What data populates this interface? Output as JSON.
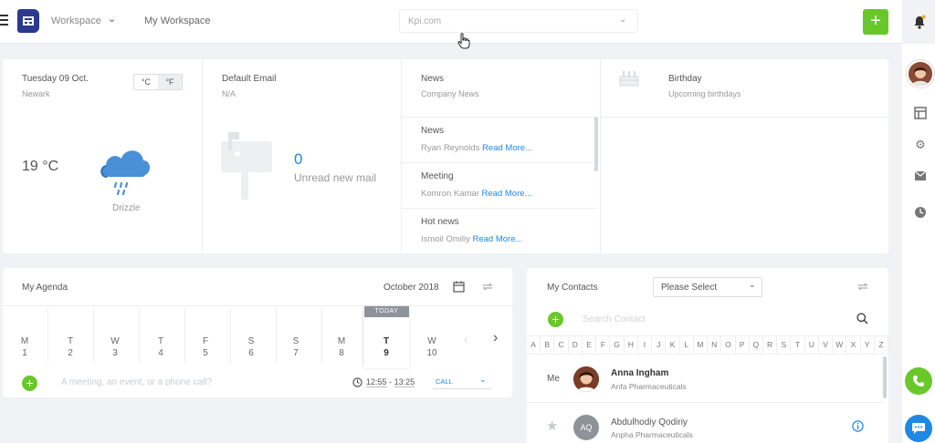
{
  "header": {
    "workspace_label": "Workspace",
    "workspace_name": "My Workspace",
    "domain": "Kpi.com",
    "add_label": "+"
  },
  "weather": {
    "date": "Tuesday 09 Oct.",
    "city": "Newark",
    "unit_c": "°C",
    "unit_f": "°F",
    "temperature": "19 °C",
    "condition": "Drizzle"
  },
  "email": {
    "title": "Default Email",
    "address": "N/A",
    "unread_count": "0",
    "unread_label": "Unread new mail"
  },
  "news": {
    "title": "News",
    "subtitle": "Company News",
    "read_more": "Read More...",
    "items": [
      {
        "title": "News",
        "author": "Ryan Reynolds"
      },
      {
        "title": "Meeting",
        "author": "Komron Kamar"
      },
      {
        "title": "Hot news",
        "author": "Ismoil Omiliy"
      }
    ]
  },
  "birthday": {
    "title": "Birthday",
    "subtitle": "Upcoming birthdays"
  },
  "agenda": {
    "title": "My Agenda",
    "month": "October 2018",
    "today_label": "TODAY",
    "days": [
      {
        "letter": "M",
        "num": "1"
      },
      {
        "letter": "T",
        "num": "2"
      },
      {
        "letter": "W",
        "num": "3"
      },
      {
        "letter": "T",
        "num": "4"
      },
      {
        "letter": "F",
        "num": "5"
      },
      {
        "letter": "S",
        "num": "6"
      },
      {
        "letter": "S",
        "num": "7"
      },
      {
        "letter": "M",
        "num": "8"
      },
      {
        "letter": "T",
        "num": "9"
      },
      {
        "letter": "W",
        "num": "10"
      }
    ],
    "new_event_placeholder": "A meeting, an event, or a phone call?",
    "time_from": "12:55",
    "time_sep": "-",
    "time_to": "13:25",
    "event_type": "CALL"
  },
  "contacts": {
    "title": "My Contacts",
    "filter": "Please Select",
    "search_placeholder": "Search Contact",
    "letters": [
      "A",
      "B",
      "C",
      "D",
      "E",
      "F",
      "G",
      "H",
      "I",
      "J",
      "K",
      "L",
      "M",
      "N",
      "O",
      "P",
      "Q",
      "R",
      "S",
      "T",
      "U",
      "V",
      "W",
      "X",
      "Y",
      "Z"
    ],
    "me_label": "Me",
    "list": [
      {
        "name": "Anna Ingham",
        "company": "Anfa Pharmaceuticals",
        "initials": ""
      },
      {
        "name": "Abdulhodiy Qodiriy",
        "company": "Anpha Pharmaceuticals",
        "initials": "AQ"
      }
    ]
  },
  "colors": {
    "accent_green": "#6ac72a",
    "accent_blue": "#1e88e5",
    "brand": "#2b3a8f"
  }
}
